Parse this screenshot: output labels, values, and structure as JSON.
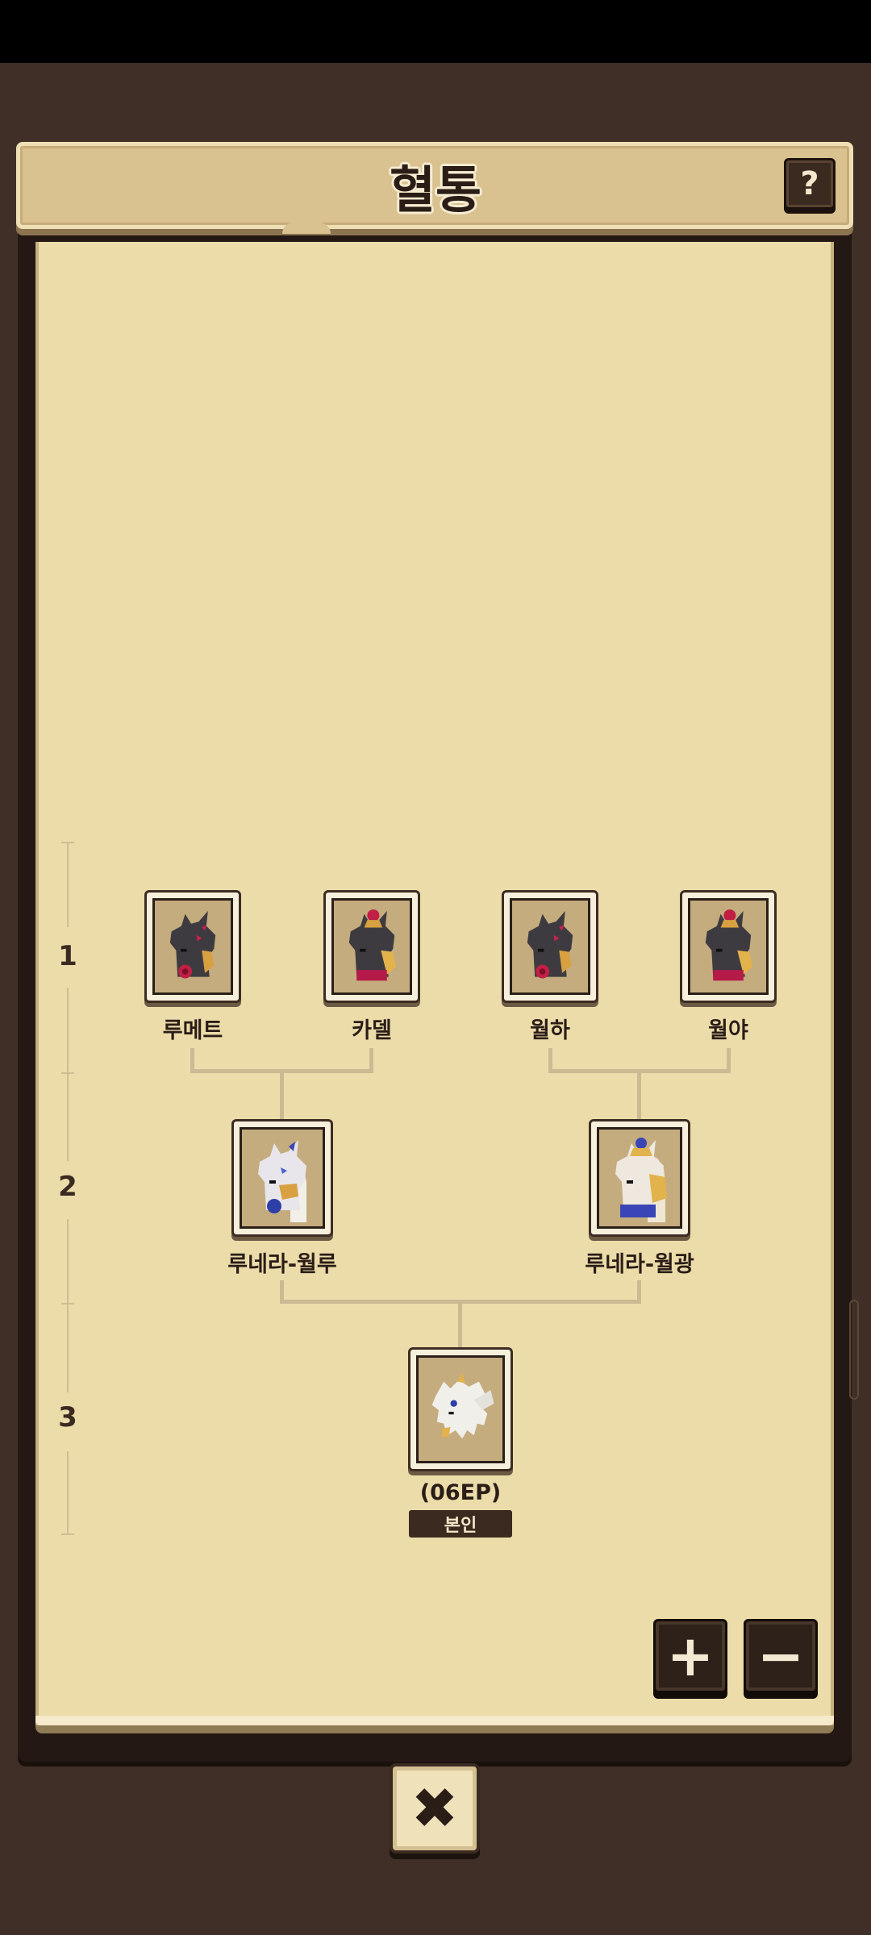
{
  "header": {
    "title": "혈통",
    "help_label": "?"
  },
  "generations": [
    "1",
    "2",
    "3"
  ],
  "tree": {
    "gen1": [
      {
        "name": "루메트",
        "icon": "dark-dragon-portrait-icon"
      },
      {
        "name": "카델",
        "icon": "dark-dragon-crowned-portrait-icon"
      },
      {
        "name": "월하",
        "icon": "dark-dragon-portrait-icon"
      },
      {
        "name": "월야",
        "icon": "dark-dragon-crowned-portrait-icon"
      }
    ],
    "gen2": [
      {
        "name": "루네라-월루",
        "icon": "white-dragon-portrait-icon"
      },
      {
        "name": "루네라-월광",
        "icon": "gold-dragon-portrait-icon"
      }
    ],
    "gen3": {
      "name": "(06EP)",
      "badge": "본인",
      "icon": "baby-dragon-portrait-icon"
    }
  },
  "controls": {
    "zoom_in": "+",
    "zoom_out": "−",
    "close": "✖"
  },
  "colors": {
    "paper": "#ecdcaa",
    "frame": "#231813",
    "accent_dark": "#3b2a1f"
  }
}
